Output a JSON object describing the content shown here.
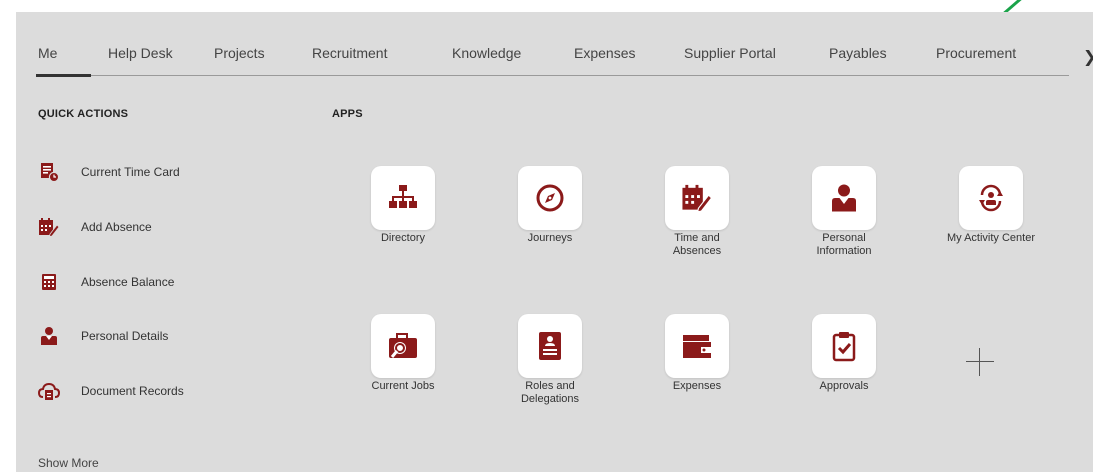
{
  "tabs": [
    {
      "label": "Me"
    },
    {
      "label": "Help Desk"
    },
    {
      "label": "Projects"
    },
    {
      "label": "Recruitment"
    },
    {
      "label": "Knowledge"
    },
    {
      "label": "Expenses"
    },
    {
      "label": "Supplier Portal"
    },
    {
      "label": "Payables"
    },
    {
      "label": "Procurement"
    }
  ],
  "active_tab": "Me",
  "quick_actions": {
    "title": "QUICK ACTIONS",
    "items": [
      {
        "label": "Current Time Card",
        "icon": "time-card-icon"
      },
      {
        "label": "Add Absence",
        "icon": "calendar-pencil-icon"
      },
      {
        "label": "Absence Balance",
        "icon": "calculator-icon"
      },
      {
        "label": "Personal Details",
        "icon": "person-icon"
      },
      {
        "label": "Document Records",
        "icon": "cloud-document-icon"
      }
    ],
    "show_more": "Show More"
  },
  "apps": {
    "title": "APPS",
    "items": [
      {
        "label": "Directory",
        "icon": "org-chart-icon"
      },
      {
        "label": "Journeys",
        "icon": "compass-icon"
      },
      {
        "label": "Time and\nAbsences",
        "icon": "calendar-pencil-icon"
      },
      {
        "label": "Personal\nInformation",
        "icon": "person-icon"
      },
      {
        "label": "My Activity Center",
        "icon": "activity-center-icon"
      },
      {
        "label": "Current Jobs",
        "icon": "briefcase-search-icon"
      },
      {
        "label": "Roles and\nDelegations",
        "icon": "badge-icon"
      },
      {
        "label": "Expenses",
        "icon": "wallet-icon"
      },
      {
        "label": "Approvals",
        "icon": "clipboard-check-icon"
      }
    ]
  },
  "colors": {
    "brand": "#8b1a1a",
    "panel_bg": "#dcdcdc",
    "annotation_arrow": "#1aa34a"
  }
}
